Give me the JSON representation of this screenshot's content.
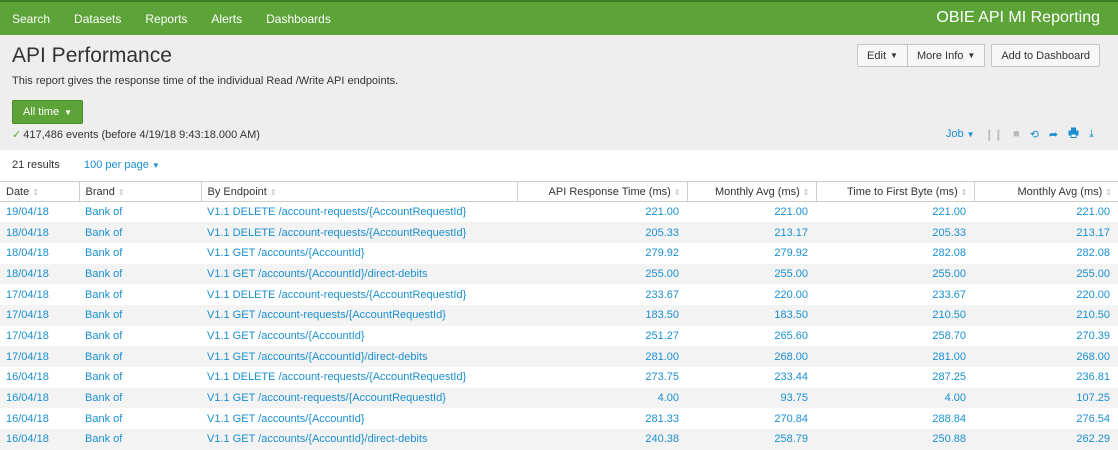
{
  "nav": {
    "items": [
      "Search",
      "Datasets",
      "Reports",
      "Alerts",
      "Dashboards"
    ],
    "app_title": "OBIE API MI Reporting"
  },
  "header": {
    "title": "API Performance",
    "description": "This report gives the response time of the individual Read /Write API endpoints.",
    "buttons": {
      "edit": "Edit",
      "more_info": "More Info",
      "add_dashboard": "Add to Dashboard"
    },
    "time_range": "All time",
    "events": "417,486 events (before 4/19/18 9:43:18.000 AM)",
    "job_label": "Job"
  },
  "results": {
    "count": "21 results",
    "per_page": "100 per page"
  },
  "table": {
    "columns": [
      "Date",
      "Brand",
      "By Endpoint",
      "API Response Time (ms)",
      "Monthly Avg (ms)",
      "Time to First Byte (ms)",
      "Monthly Avg (ms)"
    ],
    "rows": [
      [
        "19/04/18",
        "Bank of",
        "V1.1 DELETE /account-requests/{AccountRequestId}",
        "221.00",
        "221.00",
        "221.00",
        "221.00"
      ],
      [
        "18/04/18",
        "Bank of",
        "V1.1 DELETE /account-requests/{AccountRequestId}",
        "205.33",
        "213.17",
        "205.33",
        "213.17"
      ],
      [
        "18/04/18",
        "Bank of",
        "V1.1 GET /accounts/{AccountId}",
        "279.92",
        "279.92",
        "282.08",
        "282.08"
      ],
      [
        "18/04/18",
        "Bank of",
        "V1.1 GET /accounts/{AccountId}/direct-debits",
        "255.00",
        "255.00",
        "255.00",
        "255.00"
      ],
      [
        "17/04/18",
        "Bank of",
        "V1.1 DELETE /account-requests/{AccountRequestId}",
        "233.67",
        "220.00",
        "233.67",
        "220.00"
      ],
      [
        "17/04/18",
        "Bank of",
        "V1.1 GET /account-requests/{AccountRequestId}",
        "183.50",
        "183.50",
        "210.50",
        "210.50"
      ],
      [
        "17/04/18",
        "Bank of",
        "V1.1 GET /accounts/{AccountId}",
        "251.27",
        "265.60",
        "258.70",
        "270.39"
      ],
      [
        "17/04/18",
        "Bank of",
        "V1.1 GET /accounts/{AccountId}/direct-debits",
        "281.00",
        "268.00",
        "281.00",
        "268.00"
      ],
      [
        "16/04/18",
        "Bank of",
        "V1.1 DELETE /account-requests/{AccountRequestId}",
        "273.75",
        "233.44",
        "287.25",
        "236.81"
      ],
      [
        "16/04/18",
        "Bank of",
        "V1.1 GET /account-requests/{AccountRequestId}",
        "4.00",
        "93.75",
        "4.00",
        "107.25"
      ],
      [
        "16/04/18",
        "Bank of",
        "V1.1 GET /accounts/{AccountId}",
        "281.33",
        "270.84",
        "288.84",
        "276.54"
      ],
      [
        "16/04/18",
        "Bank of",
        "V1.1 GET /accounts/{AccountId}/direct-debits",
        "240.38",
        "258.79",
        "250.88",
        "262.29"
      ]
    ]
  },
  "colors": {
    "brand_green": "#5ca338",
    "link_blue": "#1a8fd0"
  },
  "icons": {
    "job_controls": [
      "pause-icon",
      "stop-icon",
      "refresh-icon",
      "share-icon",
      "print-icon",
      "export-icon"
    ]
  }
}
